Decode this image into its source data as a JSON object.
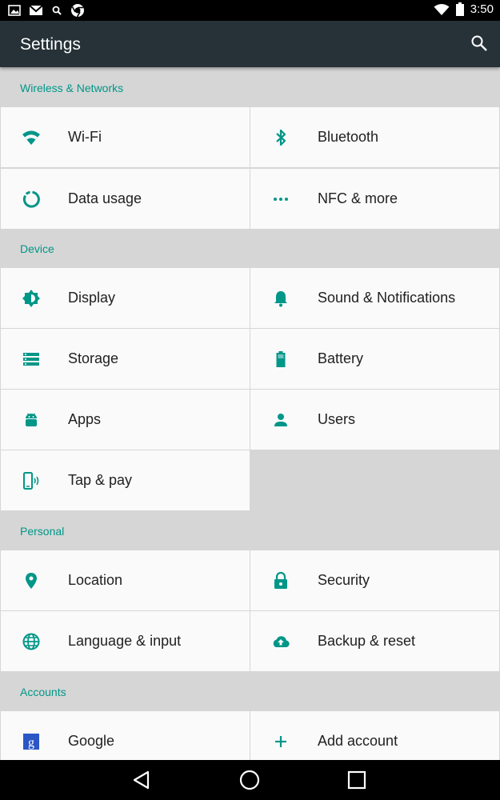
{
  "status_bar": {
    "time": "3:50",
    "left_icons": [
      "image-icon",
      "gmail-icon",
      "search-icon",
      "chrome-icon"
    ],
    "right_icons": [
      "wifi-icon",
      "battery-icon"
    ]
  },
  "app_bar": {
    "title": "Settings",
    "search_icon": "search-icon",
    "background": "#263238"
  },
  "accent_color": "#009688",
  "sections": [
    {
      "title": "Wireless & Networks",
      "items": [
        {
          "label": "Wi-Fi",
          "icon": "wifi-icon"
        },
        {
          "label": "Bluetooth",
          "icon": "bluetooth-icon"
        },
        {
          "label": "Data usage",
          "icon": "data-usage-icon"
        },
        {
          "label": "NFC & more",
          "icon": "more-dots-icon"
        }
      ]
    },
    {
      "title": "Device",
      "items": [
        {
          "label": "Display",
          "icon": "brightness-icon"
        },
        {
          "label": "Sound & Notifications",
          "icon": "bell-icon"
        },
        {
          "label": "Storage",
          "icon": "storage-icon"
        },
        {
          "label": "Battery",
          "icon": "battery-icon"
        },
        {
          "label": "Apps",
          "icon": "android-icon"
        },
        {
          "label": "Users",
          "icon": "person-icon"
        },
        {
          "label": "Tap & pay",
          "icon": "tap-pay-icon"
        }
      ]
    },
    {
      "title": "Personal",
      "items": [
        {
          "label": "Location",
          "icon": "location-pin-icon"
        },
        {
          "label": "Security",
          "icon": "lock-icon"
        },
        {
          "label": "Language & input",
          "icon": "globe-icon"
        },
        {
          "label": "Backup & reset",
          "icon": "cloud-upload-icon"
        }
      ]
    },
    {
      "title": "Accounts",
      "items": [
        {
          "label": "Google",
          "icon": "google-icon"
        },
        {
          "label": "Add account",
          "icon": "plus-icon"
        }
      ]
    }
  ],
  "nav_bar": {
    "back_icon": "back-icon",
    "home_icon": "home-icon",
    "recents_icon": "recents-icon"
  }
}
